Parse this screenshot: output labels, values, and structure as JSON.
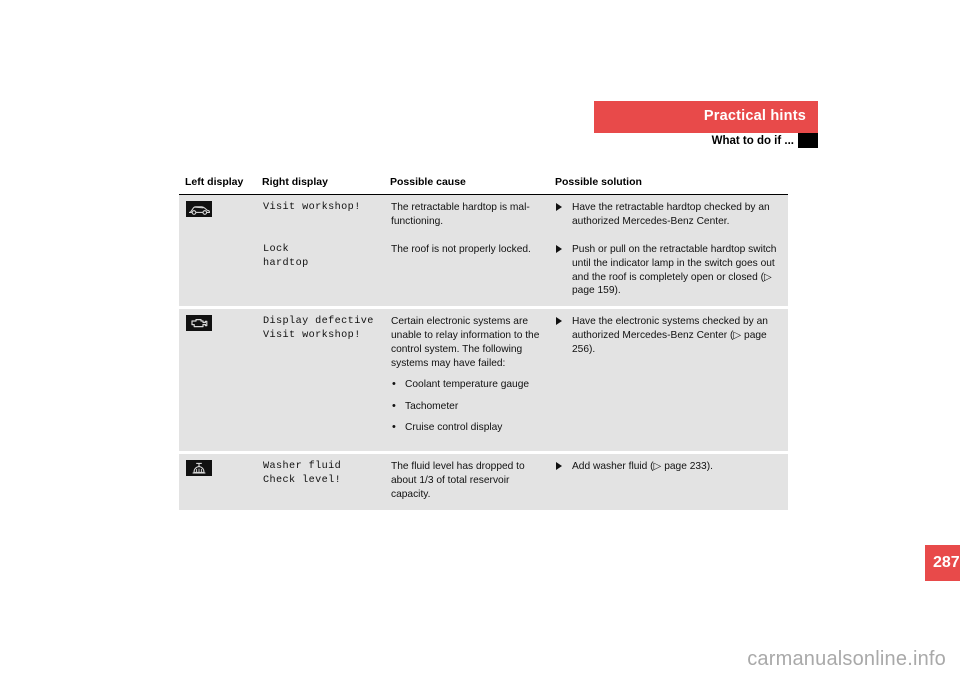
{
  "header": {
    "chapter_title": "Practical hints",
    "section_title": "What to do if ...",
    "banner_color": "#e84a4a"
  },
  "table": {
    "columns": [
      "Left display",
      "Right display",
      "Possible cause",
      "Possible solution"
    ],
    "rows": [
      {
        "left_icon": "convertible-hardtop-icon",
        "right_display": "Visit workshop!",
        "cause": "The retractable hardtop is mal-functioning.",
        "solution": "Have the retractable hardtop checked by an authorized Mercedes-Benz Center."
      },
      {
        "left_icon": "",
        "right_display": "Lock\nhardtop",
        "cause": "The roof is not properly locked.",
        "solution": "Push or pull on the retractable hardtop switch until the indicator lamp in the switch goes out and the roof is completely open or closed (▷ page 159)."
      },
      {
        "left_icon": "check-engine-icon",
        "right_display": "Display defective\nVisit workshop!",
        "cause": "Certain electronic systems are unable to relay information to the control system. The following systems may have failed:",
        "cause_list": [
          "Coolant temperature gauge",
          "Tachometer",
          "Cruise control display"
        ],
        "solution": "Have the electronic systems checked by an authorized Mercedes-Benz Center (▷ page 256)."
      },
      {
        "left_icon": "washer-fluid-icon",
        "right_display": "Washer fluid\nCheck level!",
        "cause": "The fluid level has dropped to about 1/3 of total reservoir capacity.",
        "solution": "Add washer fluid (▷ page 233)."
      }
    ]
  },
  "footer": {
    "page_number": "287",
    "watermark": "carmanualsonline.info"
  }
}
